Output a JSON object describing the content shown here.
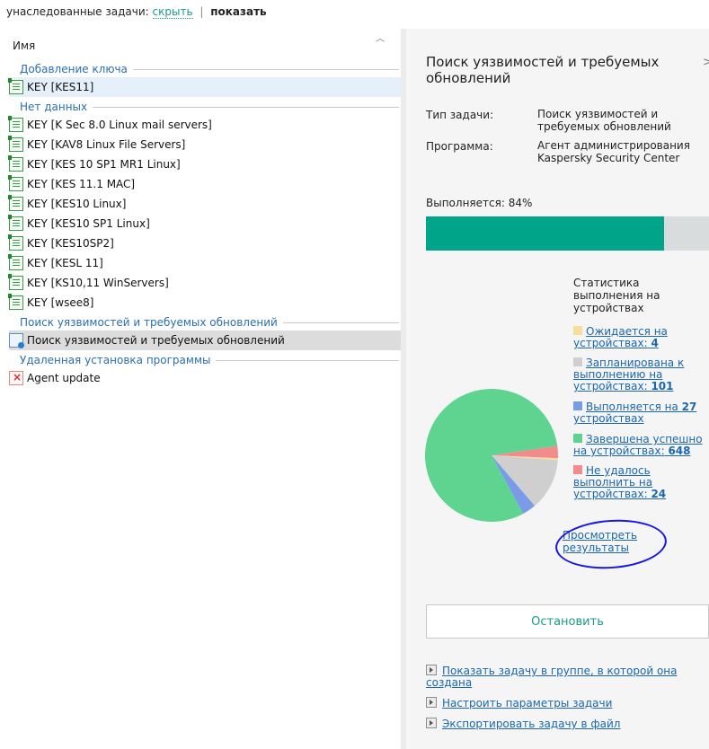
{
  "topbar": {
    "label": "унаследованные задачи:",
    "hide": "скрыть",
    "separator": "|",
    "show": "показать"
  },
  "list": {
    "column_header": "Имя",
    "sort_icon": "chevron-up-icon",
    "groups": [
      {
        "name": "Добавление ключа",
        "items": [
          {
            "name": "KEY [KES11]",
            "icon": "key-task-icon",
            "selected": "blue"
          }
        ]
      },
      {
        "name": "Нет данных",
        "items": [
          {
            "name": "KEY [K Sec 8.0 Linux mail servers]",
            "icon": "key-task-icon"
          },
          {
            "name": "KEY [KAV8 Linux File Servers]",
            "icon": "key-task-icon"
          },
          {
            "name": "KEY [KES 10 SP1 MR1 Linux]",
            "icon": "key-task-icon"
          },
          {
            "name": "KEY [KES 11.1 MAC]",
            "icon": "key-task-icon"
          },
          {
            "name": "KEY [KES10 Linux]",
            "icon": "key-task-icon"
          },
          {
            "name": "KEY [KES10 SP1 Linux]",
            "icon": "key-task-icon"
          },
          {
            "name": "KEY [KES10SP2]",
            "icon": "key-task-icon"
          },
          {
            "name": "KEY [KESL 11]",
            "icon": "key-task-icon"
          },
          {
            "name": "KEY [KS10,11 WinServers]",
            "icon": "key-task-icon"
          },
          {
            "name": "KEY [wsee8]",
            "icon": "key-task-icon"
          }
        ]
      },
      {
        "name": "Поиск уязвимостей и требуемых обновлений",
        "items": [
          {
            "name": "Поиск уязвимостей и требуемых обновлений",
            "icon": "vulnerability-scan-icon",
            "selected": "gray"
          }
        ]
      },
      {
        "name": "Удаленная установка программы",
        "items": [
          {
            "name": "Agent update",
            "icon": "remote-install-icon"
          }
        ]
      }
    ]
  },
  "details": {
    "title": "Поиск уязвимостей и требуемых обновлений",
    "close_icon": "close-icon",
    "task_type_label": "Тип задачи:",
    "task_type_value": "Поиск уязвимостей и требуемых обновлений",
    "program_label": "Программа:",
    "program_value": "Агент администрирования Kaspersky Security Center",
    "progress_label": "Выполняется:",
    "progress_text": "84%",
    "progress_value": 84,
    "stats_title": "Статистика выполнения на устройствах",
    "legend": [
      {
        "text": "Ожидается на устройствах:",
        "count": "4",
        "value": 4,
        "color": "#f8dc9c"
      },
      {
        "text": "Запланирована к выполнению на устройствах:",
        "count": "101",
        "value": 101,
        "color": "#cfcfcf"
      },
      {
        "text": "Выполняется на",
        "count": "27",
        "suffix": "устройствах",
        "value": 27,
        "color": "#7a9be8"
      },
      {
        "text": "Завершена успешно на устройствах:",
        "count": "648",
        "value": 648,
        "color": "#5fd390"
      },
      {
        "text": "Не удалось выполнить на устройствах:",
        "count": "24",
        "value": 24,
        "color": "#f28b8b"
      }
    ],
    "results_link": "Просмотреть результаты",
    "stop_button": "Остановить",
    "actions": [
      "Показать задачу в группе, в которой она создана",
      "Настроить параметры задачи",
      "Экспортировать задачу в файл"
    ]
  },
  "chart_data": {
    "type": "pie",
    "title": "Статистика выполнения на устройствах",
    "categories": [
      "Ожидается на устройствах",
      "Запланирована к выполнению на устройствах",
      "Выполняется на устройствах",
      "Завершена успешно на устройствах",
      "Не удалось выполнить на устройствах"
    ],
    "values": [
      4,
      101,
      27,
      648,
      24
    ],
    "colors": [
      "#f8dc9c",
      "#cfcfcf",
      "#7a9be8",
      "#5fd390",
      "#f28b8b"
    ]
  }
}
